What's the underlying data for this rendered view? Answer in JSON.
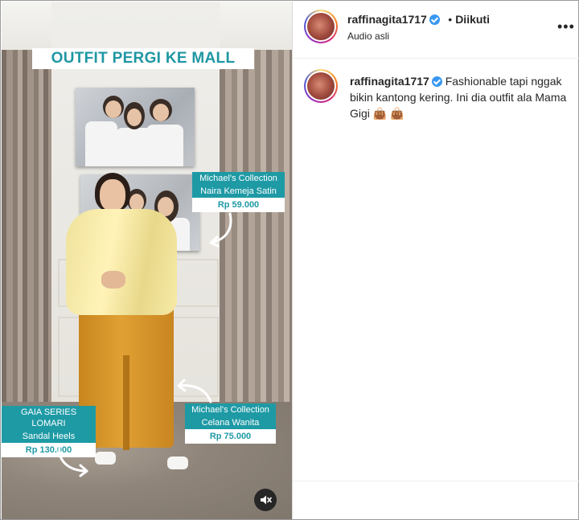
{
  "video": {
    "title_banner": "OUTFIT PERGI KE MALL",
    "tags": [
      {
        "line1": "Michael's Collection",
        "line2": "Naira Kemeja Satin",
        "price": "Rp 59.000"
      },
      {
        "line1": "GAIA SERIES LOMARI",
        "line2": "Sandal Heels",
        "price": "Rp 130.000"
      },
      {
        "line1": "Michael's Collection",
        "line2": "Celana Wanita",
        "price": "Rp 75.000"
      }
    ],
    "mute_icon": "speaker-muted-icon"
  },
  "header": {
    "username": "raffinagita1717",
    "separator": "•",
    "follow_status": "Diikuti",
    "audio": "Audio asli",
    "more_icon": "more-options-icon"
  },
  "caption": {
    "username": "raffinagita1717",
    "text": "Fashionable tapi nggak bikin kantong kering. Ini dia outfit ala Mama Gigi",
    "emoji": "👜 👜"
  },
  "colors": {
    "accent_teal": "#1e9aa5",
    "verified_blue": "#3897f0"
  }
}
